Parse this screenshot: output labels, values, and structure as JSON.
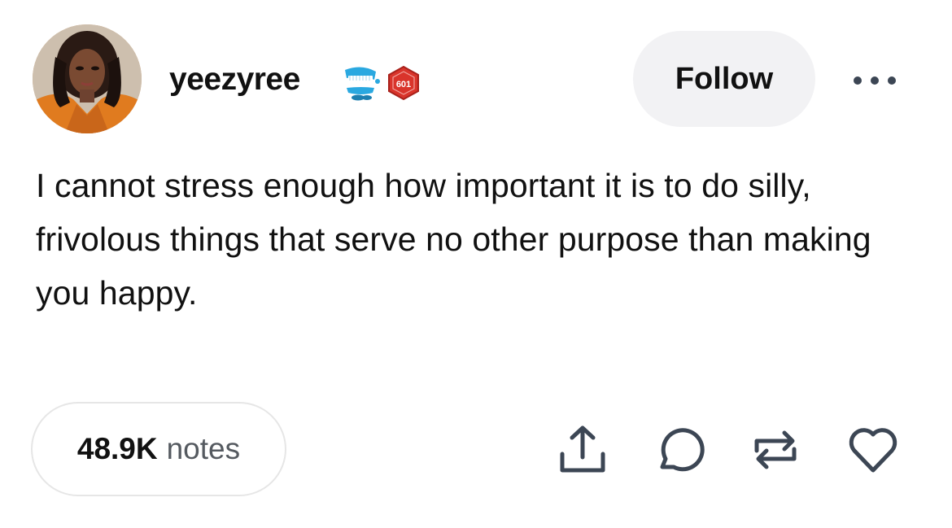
{
  "post": {
    "username": "yeezyree",
    "follow_label": "Follow",
    "badges": [
      {
        "name": "chattering-teeth-badge",
        "icon": "chattering-teeth-icon"
      },
      {
        "name": "level-badge",
        "icon": "red-shield-pin-icon",
        "text": "601"
      }
    ],
    "text": "I cannot stress enough how important it is to do silly, frivolous things that serve no other purpose than making you happy.",
    "notes": {
      "count": "48.9K",
      "label": "notes"
    },
    "actions": [
      {
        "name": "share",
        "icon": "share-icon"
      },
      {
        "name": "reply",
        "icon": "reply-icon"
      },
      {
        "name": "reblog",
        "icon": "reblog-icon"
      },
      {
        "name": "like",
        "icon": "heart-icon"
      }
    ]
  },
  "colors": {
    "text": "#111111",
    "muted": "#555a60",
    "follow_bg": "#f2f2f4",
    "icon": "#3c4654",
    "badge_red": "#d9342b",
    "badge_blue": "#2aa8e0"
  }
}
